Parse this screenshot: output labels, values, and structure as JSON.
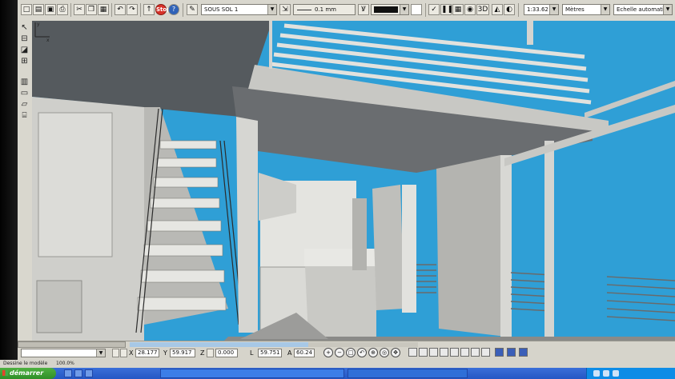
{
  "toolbar": {
    "floor_select": "SOUS SOL 1",
    "line_weight": "0.1 mm",
    "scale": "1:33.62",
    "units": "Mètres",
    "scale_mode": "Echelle automatique",
    "view_3d_label": "3D",
    "stop_label": "Stop",
    "help_label": "?"
  },
  "viewport": {
    "axis_x": "x",
    "axis_y": "y"
  },
  "coords": {
    "x_label": "X",
    "x": "28.177",
    "y_label": "Y",
    "y": "59.917",
    "z_label": "Z",
    "z": "0.000",
    "l_label": "L",
    "l": "59.751",
    "a_label": "A",
    "a": "60.24"
  },
  "status": {
    "message": "Dessine le modèle",
    "zoom": "100.0%",
    "progress": 0.62
  },
  "taskbar": {
    "start_label": "démarrer"
  },
  "colors": {
    "sky": "#2f9fd6",
    "accent_red": "#d8322a",
    "taskbar": "#2457c4",
    "start_green": "#3a9e30"
  }
}
